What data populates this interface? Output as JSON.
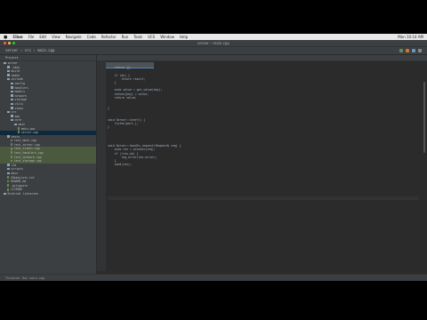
{
  "menubar": {
    "items": [
      "Clion",
      "File",
      "Edit",
      "View",
      "Navigate",
      "Code",
      "Refactor",
      "Run",
      "Tools",
      "VCS",
      "Window",
      "Help"
    ],
    "right_text": "Mon 10:14 AM"
  },
  "window": {
    "title": "server – main.cpp"
  },
  "navbar": {
    "breadcrumb": "server › src › main.cpp"
  },
  "sidebar": {
    "header": "Project",
    "items": [
      {
        "label": "server",
        "type": "folder",
        "depth": 0
      },
      {
        "label": ".idea",
        "type": "folder",
        "depth": 1
      },
      {
        "label": "build",
        "type": "folder",
        "depth": 1
      },
      {
        "label": "cmake",
        "type": "folder",
        "depth": 1
      },
      {
        "label": "include",
        "type": "folder",
        "depth": 1
      },
      {
        "label": "config",
        "type": "folder",
        "depth": 2
      },
      {
        "label": "handlers",
        "type": "folder",
        "depth": 2
      },
      {
        "label": "models",
        "type": "folder",
        "depth": 2
      },
      {
        "label": "network",
        "type": "folder",
        "depth": 2
      },
      {
        "label": "storage",
        "type": "folder",
        "depth": 2
      },
      {
        "label": "utils",
        "type": "folder",
        "depth": 2
      },
      {
        "label": "views",
        "type": "folder",
        "depth": 2
      },
      {
        "label": "src",
        "type": "folder",
        "depth": 1
      },
      {
        "label": "app",
        "type": "folder",
        "depth": 2
      },
      {
        "label": "core",
        "type": "folder",
        "depth": 2
      },
      {
        "label": "main",
        "type": "folder",
        "depth": 3
      },
      {
        "label": "main.cpp",
        "type": "file",
        "depth": 4
      },
      {
        "label": "server.cpp",
        "type": "file",
        "depth": 4,
        "state": "selected"
      },
      {
        "label": "tests",
        "type": "folder",
        "depth": 1
      },
      {
        "label": "test_main.cpp",
        "type": "file",
        "depth": 2
      },
      {
        "label": "test_server.cpp",
        "type": "file",
        "depth": 2
      },
      {
        "label": "test_client.cpp",
        "type": "file",
        "depth": 2,
        "state": "highlight"
      },
      {
        "label": "test_handlers.cpp",
        "type": "file",
        "depth": 2,
        "state": "highlight"
      },
      {
        "label": "test_network.cpp",
        "type": "file",
        "depth": 2,
        "state": "highlight"
      },
      {
        "label": "test_storage.cpp",
        "type": "file",
        "depth": 2,
        "state": "highlight"
      },
      {
        "label": "lib",
        "type": "folder",
        "depth": 1
      },
      {
        "label": "scripts",
        "type": "folder",
        "depth": 1
      },
      {
        "label": "docs",
        "type": "folder",
        "depth": 1
      },
      {
        "label": "CMakeLists.txt",
        "type": "file",
        "depth": 1
      },
      {
        "label": "README.md",
        "type": "file",
        "depth": 1
      },
      {
        "label": ".gitignore",
        "type": "file",
        "depth": 1
      },
      {
        "label": "LICENSE",
        "type": "file",
        "depth": 1
      },
      {
        "label": "External Libraries",
        "type": "folder",
        "depth": 0
      }
    ]
  },
  "code": {
    "lines": [
      "",
      "    return {};",
      "",
      "    if (ok) {",
      "        return result;",
      "    }",
      "",
      "    auto value = get_value(key);",
      "    values[key] = value;",
      "    return value;",
      "",
      "",
      "}",
      "",
      "",
      "void Server::start() {",
      "    listen(port_);",
      "}",
      "",
      "",
      "",
      "",
      "void Server::handle_request(Request& req) {",
      "    auto res = process(req);",
      "    if (!res.ok) {",
      "        log_error(res.error);",
      "    }",
      "    send(res);",
      "",
      "",
      "",
      "",
      "",
      "",
      "",
      "",
      "",
      "",
      "",
      ""
    ],
    "current_line": 36
  },
  "statusbar": {
    "text": "Terminal    Run    main.cpp"
  }
}
